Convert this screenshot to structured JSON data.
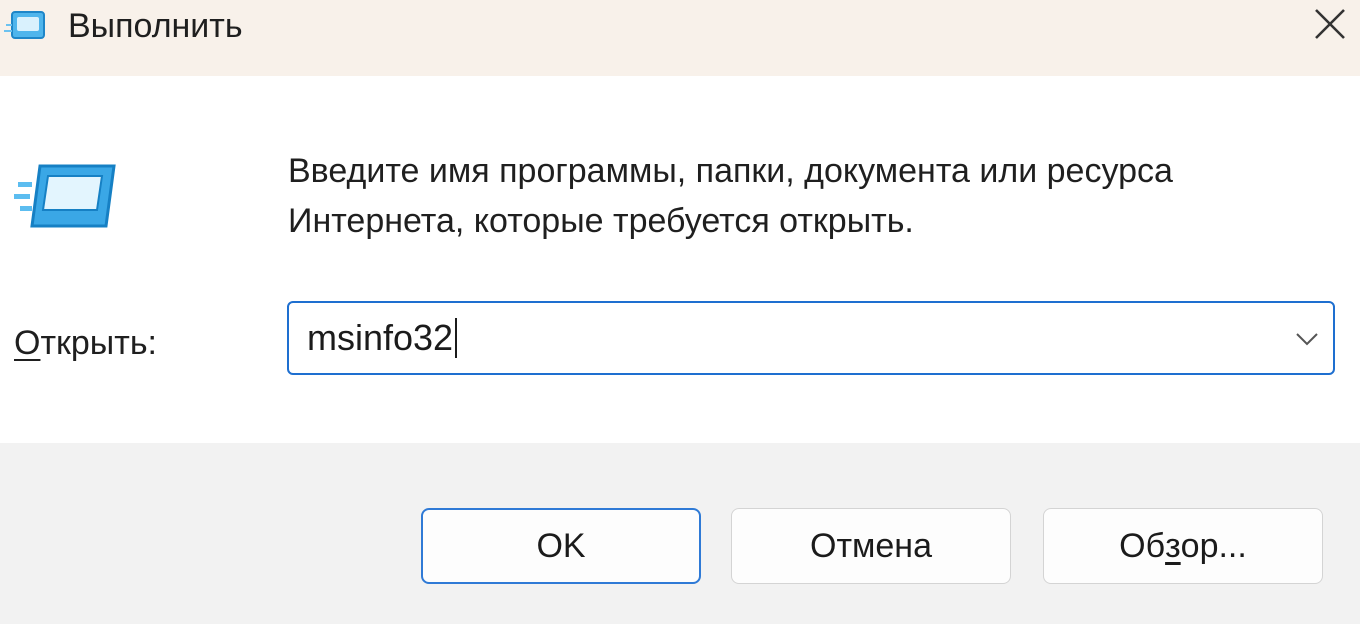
{
  "window": {
    "title": "Выполнить",
    "title_icon": "run-app-icon",
    "close_icon": "close-icon"
  },
  "body": {
    "app_icon": "run-app-icon",
    "description": "Введите имя программы, папки, документа или ресурса Интернета, которые требуется открыть.",
    "open_label_accel": "О",
    "open_label_rest": "ткрыть:",
    "open_value": "msinfo32",
    "dropdown_icon": "chevron-down-icon"
  },
  "buttons": {
    "ok": "OK",
    "cancel": "Отмена",
    "browse_pre": "Об",
    "browse_accel": "з",
    "browse_post": "ор..."
  },
  "colors": {
    "titlebar_bg": "#f8f1ea",
    "footer_bg": "#f2f2f2",
    "focus_accent": "#1e6fd0",
    "icon_blue": "#3aa7e6"
  }
}
